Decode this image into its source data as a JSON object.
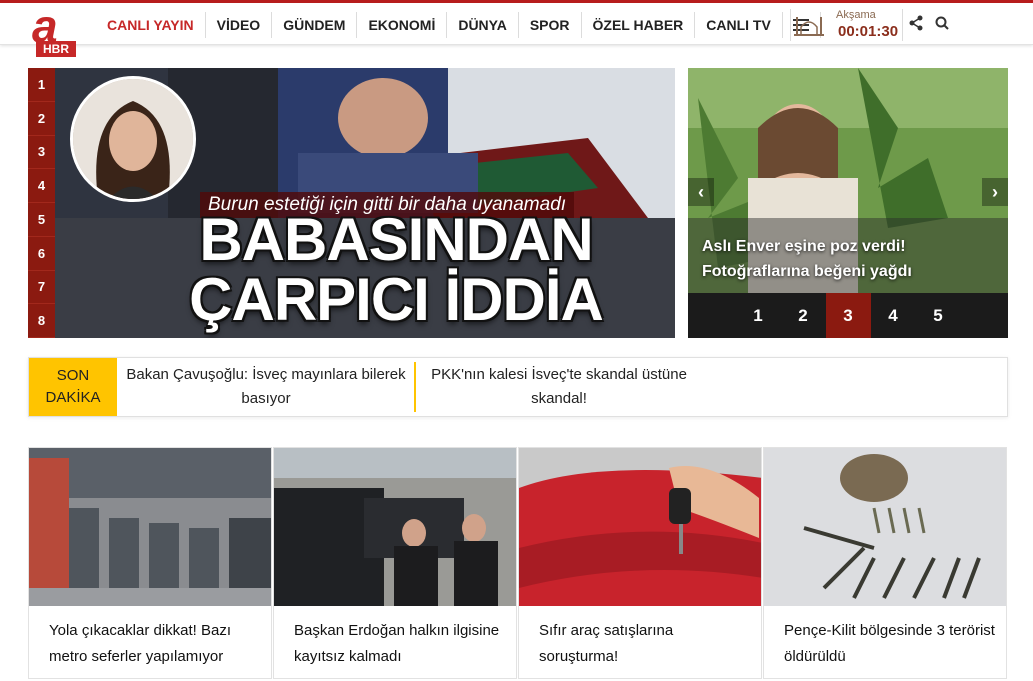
{
  "header": {
    "logo_text": "a",
    "logo_sub": "HBR",
    "nav": [
      "CANLI YAYIN",
      "VİDEO",
      "GÜNDEM",
      "EKONOMİ",
      "DÜNYA",
      "SPOR",
      "ÖZEL HABER",
      "CANLI TV"
    ],
    "prayer_label": "Akşama",
    "prayer_time": "00:01:30",
    "accent": "#c62828"
  },
  "hero": {
    "numbers": [
      "1",
      "2",
      "3",
      "4",
      "5",
      "6",
      "7",
      "8"
    ],
    "subtitle": "Burun estetiği için gitti bir daha uyanamadı",
    "title_line1": "BABASINDAN",
    "title_line2": "ÇARPICI İDDİA"
  },
  "side": {
    "caption": "Aslı Enver eşine poz verdi! Fotoğraflarına beğeni yağdı",
    "pages": [
      "1",
      "2",
      "3",
      "4",
      "5"
    ],
    "active_page": "3"
  },
  "breaking": {
    "label_line1": "SON",
    "label_line2": "DAKİKA",
    "items": [
      "Bakan Çavuşoğlu: İsveç mayınlara bilerek basıyor",
      "PKK'nın kalesi İsveç'te skandal üstüne skandal!"
    ]
  },
  "cards": [
    {
      "title": "Yola çıkacaklar dikkat! Bazı metro seferler yapılamıyor"
    },
    {
      "title": "Başkan Erdoğan halkın ilgisine kayıtsız kalmadı"
    },
    {
      "title": "Sıfır araç satışlarına soruşturma!"
    },
    {
      "title": "Pençe-Kilit bölgesinde 3 terörist öldürüldü"
    }
  ]
}
